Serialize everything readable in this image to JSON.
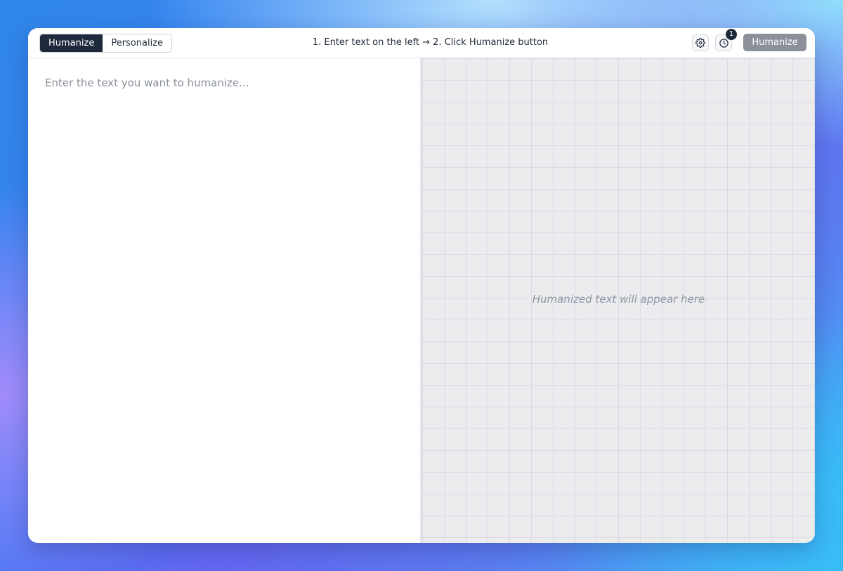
{
  "toolbar": {
    "modes": [
      {
        "label": "Humanize",
        "active": true
      },
      {
        "label": "Personalize",
        "active": false
      }
    ],
    "instructions": "1. Enter text on the left → 2. Click Humanize button",
    "settings_icon": "gear-icon",
    "history_icon": "clock-icon",
    "history_count": "1",
    "humanize_label": "Humanize"
  },
  "input": {
    "value": "",
    "placeholder": "Enter the text you want to humanize..."
  },
  "output": {
    "placeholder": "Humanized text will appear here"
  },
  "colors": {
    "active_mode_bg": "#1e293b",
    "humanize_button_bg": "#8b9099",
    "output_bg": "#ececef"
  }
}
